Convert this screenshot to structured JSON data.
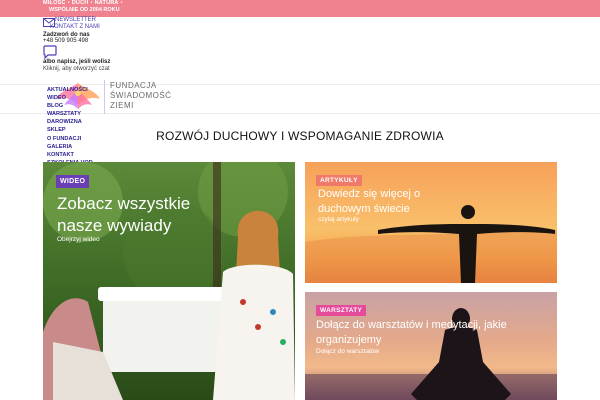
{
  "topbar": {
    "slogan": [
      "MIŁOŚĆ",
      "DUCH",
      "NATURA"
    ],
    "separator": "•",
    "since": "WSPÓLNIE OD 2004 ROKU"
  },
  "contact": {
    "newsletter": "NEWSLETTER",
    "contact_us": "KONTAKT Z NAMI",
    "call_label": "Zadzwoń do nas",
    "phone": "+48 509 905 498",
    "write_label": "albo napisz, jeśli wolisz",
    "chat_hint": "Kliknij, aby otworzyć czat"
  },
  "logo": {
    "lines": [
      "FUNDACJA",
      "ŚWIADOMOŚĆ",
      "ZIEMI"
    ]
  },
  "nav": {
    "items": [
      "AKTUALNOŚCI",
      "WIDEO",
      "BLOG",
      "WARSZTATY",
      "DAROWIZNA",
      "SKLEP",
      "O FUNDACJI",
      "GALERIA",
      "KONTAKT",
      "SZKOLENIA VOD"
    ]
  },
  "page": {
    "heading": "ROZWÓJ DUCHOWY I WSPOMAGANIE ZDROWIA"
  },
  "cards": {
    "video": {
      "badge": "WIDEO",
      "title": "Zobacz wszystkie nasze wywiady",
      "link": "Obejrzyj wideo"
    },
    "articles": {
      "badge": "ARTYKUŁY",
      "title": "Dowiedz się więcej o duchowym świecie",
      "link": "czytaj artykuły"
    },
    "workshops": {
      "badge": "WARSZTATY",
      "title": "Dołącz do warsztatów i medytacji, jakie organizujemy",
      "link": "Dołącz do warsztatów"
    }
  },
  "colors": {
    "topbar": "#f0818e",
    "nav_text": "#2a1f8f",
    "badge_video": "#6a3fb5",
    "badge_articles": "#f07a6a",
    "badge_workshops": "#e64a9a"
  }
}
